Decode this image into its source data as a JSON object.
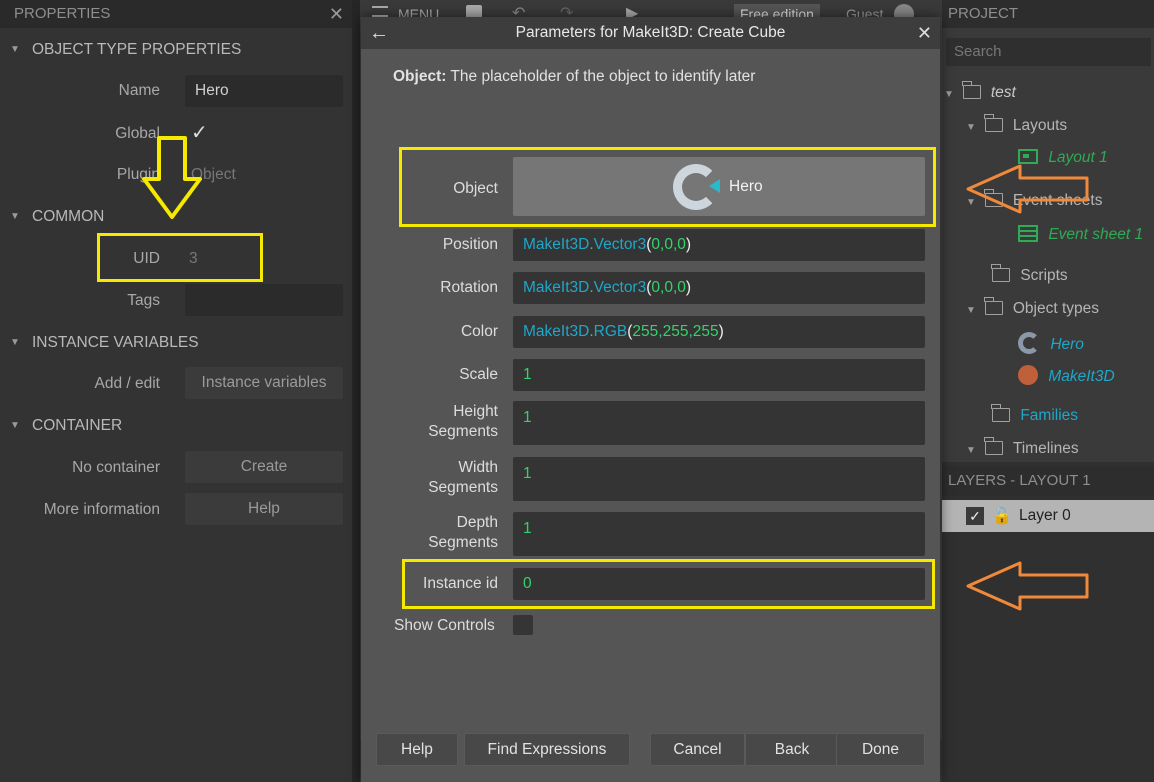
{
  "properties": {
    "title": "PROPERTIES",
    "close": "✕",
    "object_type_section": "OBJECT TYPE PROPERTIES",
    "name_label": "Name",
    "name_value": "Hero",
    "global_label": "Global",
    "global_checked": "✓",
    "plugin_label": "Plugin",
    "plugin_value": "Object",
    "common_section": "COMMON",
    "uid_label": "UID",
    "uid_value": "3",
    "tags_label": "Tags",
    "tags_value": "",
    "instance_vars_section": "INSTANCE VARIABLES",
    "add_edit_label": "Add / edit",
    "instance_vars_button": "Instance variables",
    "container_section": "CONTAINER",
    "no_container_label": "No container",
    "create_button": "Create",
    "more_info_label": "More information",
    "help_button": "Help"
  },
  "toolbar": {
    "menu_label": "MENU",
    "edition": "Free edition",
    "guest": "Guest"
  },
  "project": {
    "title": "PROJECT",
    "search_placeholder": "Search",
    "root": "test",
    "layouts": "Layouts",
    "layout1": "Layout 1",
    "event_sheets": "Event sheets",
    "event_sheet1": "Event sheet 1",
    "scripts": "Scripts",
    "object_types": "Object types",
    "hero": "Hero",
    "makeit3d": "MakeIt3D",
    "families": "Families",
    "timelines": "Timelines"
  },
  "layers": {
    "title": "LAYERS - LAYOUT 1",
    "layer0": "Layer 0"
  },
  "dialog": {
    "title": "Parameters for MakeIt3D: Create Cube",
    "back_arrow": "←",
    "close": "✕",
    "desc_bold": "Object:",
    "desc_text": " The placeholder of the object to identify later",
    "object_label": "Object",
    "object_value": "Hero",
    "position_label": "Position",
    "position_a": "MakeIt3D",
    "position_b": ".",
    "position_c": "Vector3",
    "position_d": "(",
    "position_e": "0,0,0",
    "position_f": ")",
    "rotation_label": "Rotation",
    "rotation_a": "MakeIt3D",
    "rotation_b": ".",
    "rotation_c": "Vector3",
    "rotation_d": "(",
    "rotation_e": "0,0,0",
    "rotation_f": ")",
    "color_label": "Color",
    "color_a": "MakeIt3D",
    "color_b": ".",
    "color_c": "RGB",
    "color_d": "(",
    "color_e": "255,255,255",
    "color_f": ")",
    "scale_label": "Scale",
    "scale_value": "1",
    "height_label_1": "Height",
    "height_label_2": "Segments",
    "height_value": "1",
    "width_label_1": "Width",
    "width_label_2": "Segments",
    "width_value": "1",
    "depth_label_1": "Depth",
    "depth_label_2": "Segments",
    "depth_value": "1",
    "instance_id_label": "Instance id",
    "instance_id_value": "0",
    "show_controls_label": "Show Controls",
    "help": "Help",
    "find_expressions": "Find Expressions",
    "cancel": "Cancel",
    "back": "Back",
    "done": "Done"
  },
  "colors": {
    "highlight_yellow": "#f5e900",
    "arrow_orange": "#f0893a",
    "expr_cyan": "#1fa7c9",
    "expr_green": "#32d46a"
  }
}
